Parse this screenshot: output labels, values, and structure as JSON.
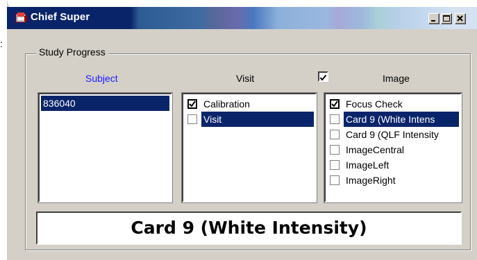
{
  "window": {
    "title": "Chief Super",
    "icon": "app-icon",
    "buttons": [
      "minimize-button",
      "maximize-button",
      "close-button"
    ]
  },
  "stray_glyph": ":",
  "group": {
    "label": "Study Progress"
  },
  "columns": {
    "subject_header": "Subject",
    "visit_header": "Visit",
    "image_header": "Image",
    "image_header_checked": true
  },
  "subject_list": {
    "items": [
      {
        "label": "836040",
        "selected": true
      }
    ]
  },
  "visit_list": {
    "items": [
      {
        "label": "Calibration",
        "checked": true,
        "selected": false
      },
      {
        "label": "Visit",
        "checked": false,
        "selected": true
      }
    ]
  },
  "image_list": {
    "items": [
      {
        "label": "Focus Check",
        "checked": true,
        "selected": false
      },
      {
        "label": "Card 9 (White Intens",
        "checked": false,
        "selected": true
      },
      {
        "label": "Card 9 (QLF Intensity",
        "checked": false,
        "selected": false
      },
      {
        "label": "ImageCentral",
        "checked": false,
        "selected": false
      },
      {
        "label": "ImageLeft",
        "checked": false,
        "selected": false
      },
      {
        "label": "ImageRight",
        "checked": false,
        "selected": false
      }
    ]
  },
  "current_step": "Card 9 (White Intensity)",
  "colors": {
    "titlebar_active": "#0a246a",
    "selection": "#0a246a",
    "subject_header": "#1a1aff",
    "face": "#d4d0c8"
  }
}
